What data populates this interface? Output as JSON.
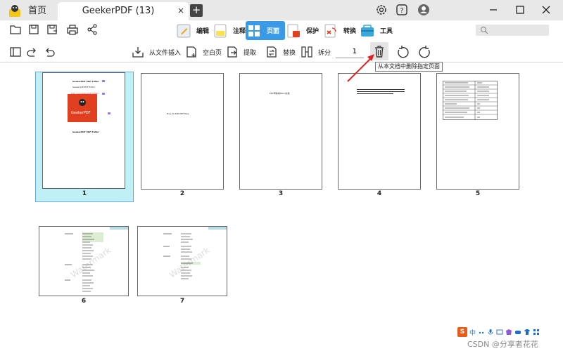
{
  "titlebar": {
    "home_tab": "首页",
    "doc_tab": "GeekerPDF (13)",
    "close_glyph": "×",
    "add_glyph": "+"
  },
  "modes": [
    {
      "label": "编辑",
      "icon": "edit-mode-icon"
    },
    {
      "label": "注释",
      "icon": "annotate-mode-icon"
    },
    {
      "label": "页面",
      "icon": "page-mode-icon"
    },
    {
      "label": "保护",
      "icon": "protect-mode-icon"
    },
    {
      "label": "转换",
      "icon": "convert-mode-icon"
    },
    {
      "label": "工具",
      "icon": "tools-mode-icon"
    }
  ],
  "page_toolbar": {
    "insert_from_file": "从文件插入",
    "blank_page": "空白页",
    "extract": "提取",
    "replace": "替换",
    "split": "拆分",
    "page_number": "1"
  },
  "tooltip": "从本文档中删除指定页面",
  "pages": [
    {
      "num": "1",
      "selected": true
    },
    {
      "num": "2",
      "selected": false
    },
    {
      "num": "3",
      "selected": false
    },
    {
      "num": "4",
      "selected": false
    },
    {
      "num": "5",
      "selected": false
    },
    {
      "num": "6",
      "selected": false
    },
    {
      "num": "7",
      "selected": false
    }
  ],
  "page1": {
    "logo_text": "GeekerPDF",
    "heading1": "GeekerPDF PDF Editor",
    "heading2": "Geekerpdf PDF Editor",
    "red_line": "Edit / Annotate PDF Editor",
    "footer": "GeekerPDF PDF Editor"
  },
  "page2": {
    "text": "How To Edit PDF files"
  },
  "page3": {
    "text": "PDF转换成Word文档"
  },
  "watermark": "Watermark",
  "ime": {
    "icon": "S",
    "lang": "中"
  },
  "footer_credit": "CSDN @分享者花花",
  "colors": {
    "accent": "#3b9ae8",
    "selected_bg": "#bff0f5",
    "arrow": "#e02020",
    "logo_red": "#e0401f"
  }
}
